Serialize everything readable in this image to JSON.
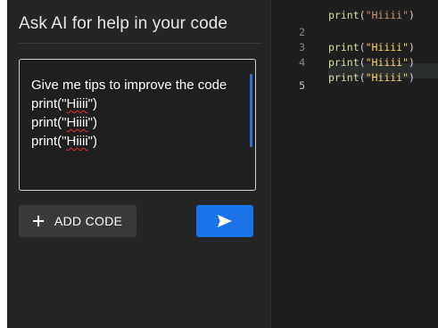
{
  "panel": {
    "title": "Ask AI for help in your code",
    "prompt_text": "Give me tips to improve the code",
    "prompt_lines": [
      {
        "pre": "print(\"",
        "word": "Hiiii",
        "post": "\")"
      },
      {
        "pre": "print(\"",
        "word": "Hiiii",
        "post": "\")"
      },
      {
        "pre": "print(\"",
        "word": "Hiiii",
        "post": "\")"
      }
    ],
    "add_code_label": "ADD CODE",
    "add_icon": "plus-icon",
    "send_icon": "send-icon"
  },
  "editor": {
    "lines": [
      {
        "num": "2",
        "fn": "print",
        "open": "(",
        "str": "\"Hiiii\"",
        "close": ")"
      },
      {
        "num": "3",
        "fn": "print",
        "open": "(",
        "str": "\"Hiiii\"",
        "close": ")"
      },
      {
        "num": "4",
        "fn": "print",
        "open": "(",
        "str": "\"Hiiii\"",
        "close": ")"
      },
      {
        "num": "5",
        "fn": "",
        "open": "",
        "str": "",
        "close": ""
      }
    ]
  },
  "colors": {
    "accent": "#1a73e8",
    "panel_bg": "#252526",
    "editor_bg": "#1e1e1e"
  }
}
